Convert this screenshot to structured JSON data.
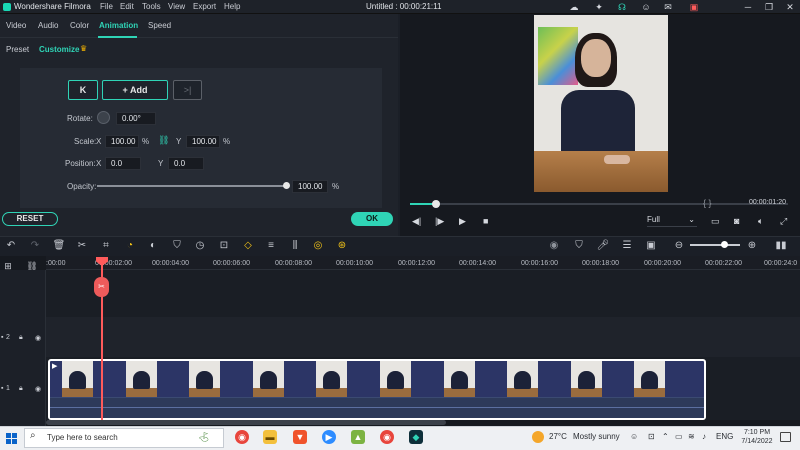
{
  "titlebar": {
    "app_name": "Wondershare Filmora",
    "menu": [
      "File",
      "Edit",
      "Tools",
      "View",
      "Export",
      "Help"
    ],
    "document_title": "Untitled : 00:00:21:11"
  },
  "tabs": [
    "Video",
    "Audio",
    "Color",
    "Animation",
    "Speed"
  ],
  "subtabs": [
    "Preset",
    "Customize"
  ],
  "keyframe": {
    "add_label": "Add",
    "add_glyph": "+"
  },
  "properties": {
    "rotate_label": "Rotate:",
    "rotate_value": "0.00°",
    "scale_label": "Scale:",
    "scale_x_label": "X",
    "scale_x_value": "100.00",
    "scale_y_label": "Y",
    "scale_y_value": "100.00",
    "percent": "%",
    "position_label": "Position:",
    "position_x_label": "X",
    "position_x_value": "0.0",
    "position_y_label": "Y",
    "position_y_value": "0.0",
    "opacity_label": "Opacity:",
    "opacity_value": "100.00",
    "opacity_fraction": 1.0
  },
  "buttons": {
    "reset": "RESET",
    "ok": "OK"
  },
  "preview": {
    "time": "00:00:01:20",
    "quality": "Full",
    "brackets": "{   }",
    "progress_fraction": 0.07
  },
  "ruler": {
    "ticks": [
      ":00:00",
      "00:00:02:00",
      "00:00:04:00",
      "00:00:06:00",
      "00:00:08:00",
      "00:00:10:00",
      "00:00:12:00",
      "00:00:14:00",
      "00:00:16:00",
      "00:00:18:00",
      "00:00:20:00",
      "00:00:22:00",
      "00:00:24:0"
    ]
  },
  "tracks": {
    "track2": "2",
    "track1": "1"
  },
  "taskbar": {
    "search_placeholder": "Type here to search",
    "temperature": "27°C",
    "weather": "Mostly sunny",
    "language": "ENG",
    "time": "7:10 PM",
    "date": "7/14/2022"
  }
}
